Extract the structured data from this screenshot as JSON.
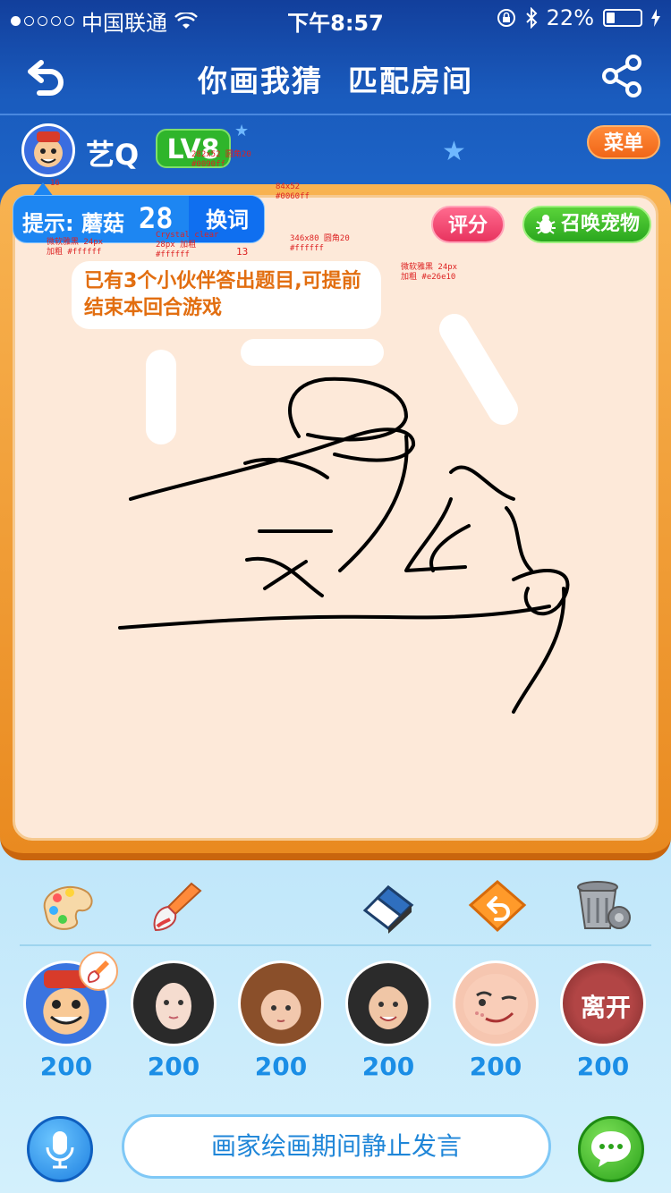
{
  "status_bar": {
    "carrier": "中国联通",
    "time": "下午8:57",
    "battery": "22%",
    "signal_dots_filled": 1,
    "signal_dots_total": 5
  },
  "header": {
    "title_part1": "你画我猜",
    "title_part2": "匹配房间",
    "back_icon": "back-arrow-icon",
    "share_icon": "share-icon"
  },
  "user": {
    "name": "艺Q",
    "level": "LV8",
    "menu_label": "菜单"
  },
  "board": {
    "hint_label": "提示: 蘑菇",
    "hint_count": "28",
    "change_word_label": "换词",
    "rate_label": "评分",
    "pet_label": "召唤宠物",
    "notice_text": "已有3个小伙伴答出题目,可提前结束本回合游戏"
  },
  "annotations": {
    "a16": "16",
    "hint_spec": "282x52 圆角20\n#0090ff",
    "font_spec_hint": "微软雅黑 24px\n加粗 #ffffff",
    "font_spec_count": "Crystal clear\n28px 加粗\n#ffffff",
    "a13": "13",
    "change_spec": "84x52\n#0060ff",
    "notice_spec": "346x80 圆角20\n#ffffff",
    "notice_font_spec": "微软雅黑 24px\n加粗 #e26e10"
  },
  "tools": [
    {
      "icon": "palette-icon"
    },
    {
      "icon": "brush-icon"
    },
    {
      "icon": "eraser-icon"
    },
    {
      "icon": "undo-icon"
    },
    {
      "icon": "trash-icon"
    }
  ],
  "players": [
    {
      "score": "200",
      "avatar": "cartoon-avatar"
    },
    {
      "score": "200",
      "avatar": "woman-avatar"
    },
    {
      "score": "200",
      "avatar": "child-avatar"
    },
    {
      "score": "200",
      "avatar": "woman-smile-avatar"
    },
    {
      "score": "200",
      "avatar": "meme-face-avatar"
    },
    {
      "score": "200",
      "avatar": "leave-avatar",
      "overlay": "离开"
    }
  ],
  "bottom": {
    "chat_placeholder": "画家绘画期间静止发言",
    "mic_icon": "microphone-icon",
    "chat_icon": "chat-bubble-icon"
  },
  "colors": {
    "hint_bg": "#1d86f2",
    "change_bg": "#0f6ff0",
    "notice_text": "#e26e10",
    "score": "#1b8ee6"
  }
}
